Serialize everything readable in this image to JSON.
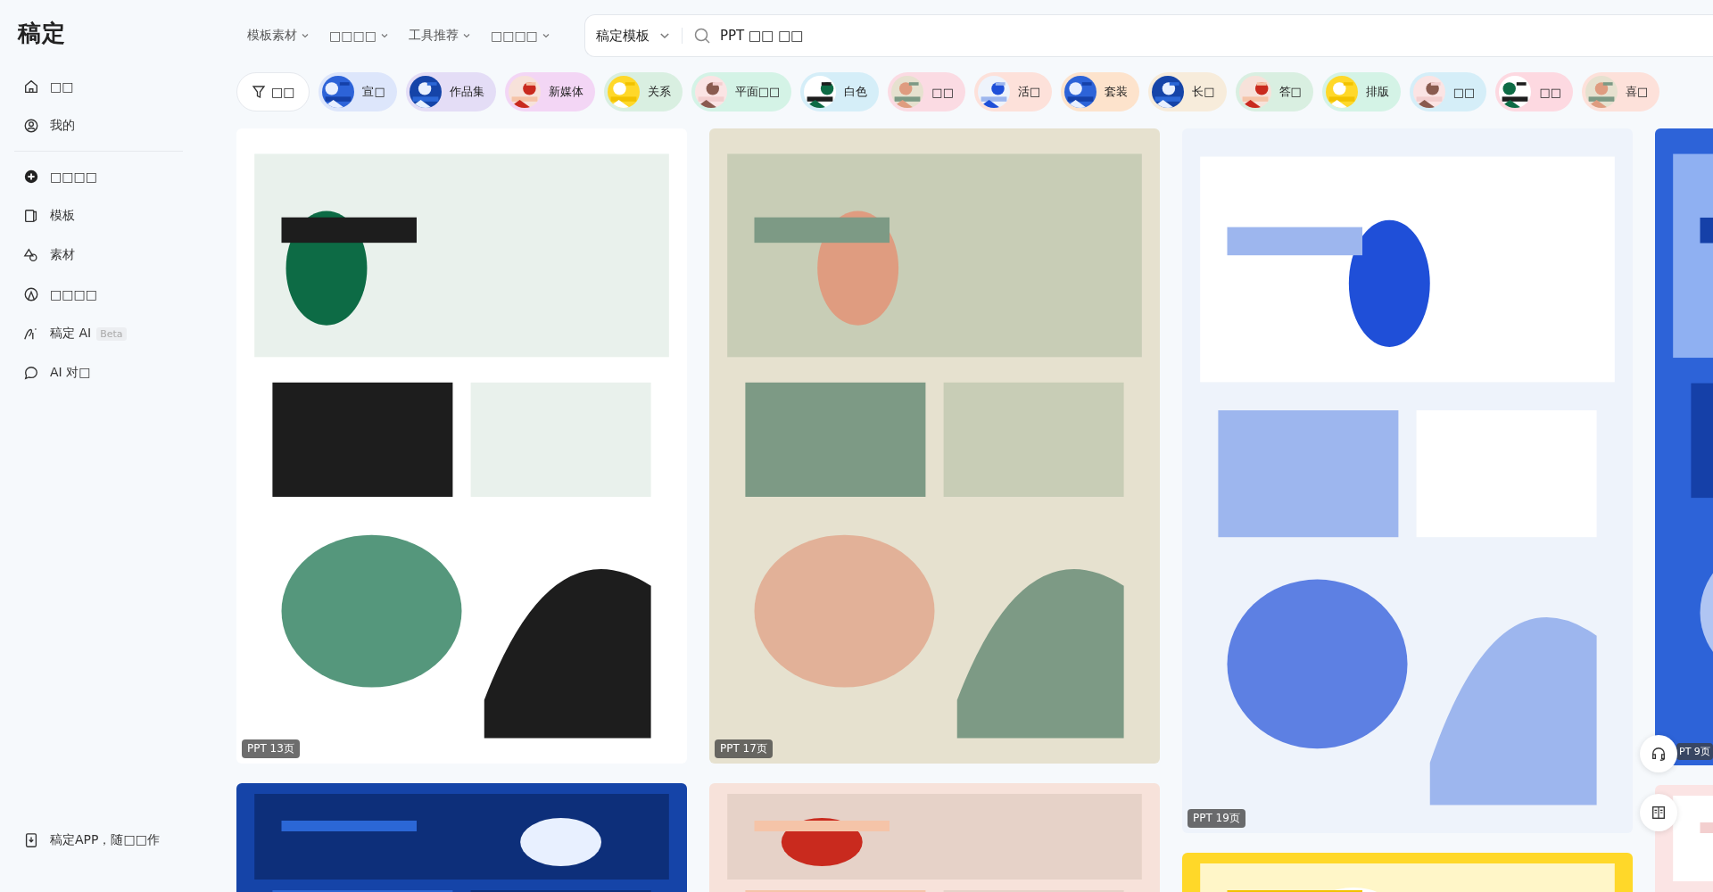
{
  "logo": "稿定",
  "sidebar": {
    "items": [
      {
        "label": "□□"
      },
      {
        "label": "我的"
      }
    ],
    "create_items": [
      {
        "label": "□□□□"
      },
      {
        "label": "模板"
      },
      {
        "label": "素材"
      },
      {
        "label": "□□□□"
      },
      {
        "label": "稿定 AI",
        "badge": "Beta"
      },
      {
        "label": "AI 对□"
      }
    ],
    "footer": "稿定APP，随□□作"
  },
  "nav": [
    {
      "label": "模板素材"
    },
    {
      "label": "□□□□"
    },
    {
      "label": "工具推荐"
    },
    {
      "label": "□□□□"
    }
  ],
  "search": {
    "scope": "稿定模板",
    "value": "PPT □□ □□"
  },
  "filter_button": "□□",
  "chips": [
    {
      "label": "宣□",
      "color": "#dde6fb"
    },
    {
      "label": "作品集",
      "color": "#e4ddf6"
    },
    {
      "label": "新媒体",
      "color": "#f3d6f5"
    },
    {
      "label": "关系",
      "color": "#d9efe1"
    },
    {
      "label": "平面□□",
      "color": "#d4f3e6"
    },
    {
      "label": "白色",
      "color": "#d5eef8"
    },
    {
      "label": "□□",
      "color": "#fbdbe3"
    },
    {
      "label": "活□",
      "color": "#fde1da"
    },
    {
      "label": "套装",
      "color": "#fde3cc"
    },
    {
      "label": "长□",
      "color": "#f7ecdb"
    },
    {
      "label": "答□",
      "color": "#d9efe1"
    },
    {
      "label": "排版",
      "color": "#d4f3e6"
    },
    {
      "label": "□□",
      "color": "#d5eef8"
    },
    {
      "label": "□□",
      "color": "#fdd9e1"
    },
    {
      "label": "喜□",
      "color": "#fde1da"
    }
  ],
  "columns": [
    {
      "cards": [
        {
          "kind": "picture",
          "badge": "PPT 13页"
        },
        {
          "kind": "picture"
        }
      ]
    },
    {
      "cards": [
        {
          "kind": "picture",
          "badge": "PPT 17页"
        },
        {
          "kind": "picture"
        }
      ]
    },
    {
      "cards": [
        {
          "kind": "picture",
          "badge": "PPT 19页"
        },
        {
          "kind": "picture"
        }
      ]
    },
    {
      "cards": [
        {
          "kind": "picture",
          "badge": "PT 9页"
        },
        {
          "kind": "picture"
        }
      ]
    }
  ]
}
